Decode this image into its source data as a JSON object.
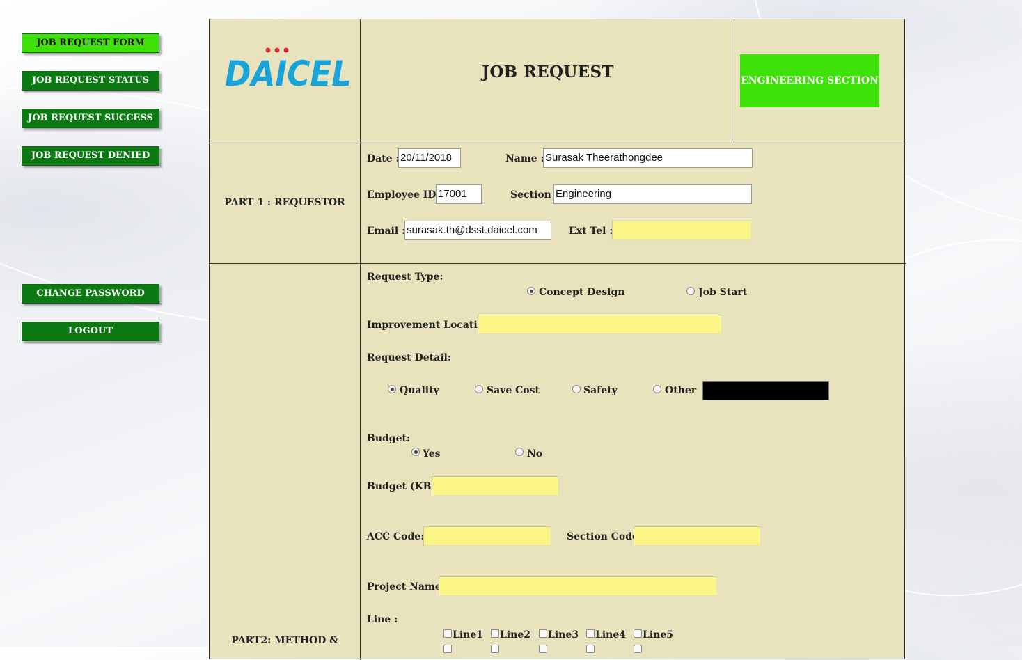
{
  "sidebar": {
    "items": [
      {
        "label": "JOB REQUEST FORM"
      },
      {
        "label": "JOB REQUEST STATUS"
      },
      {
        "label": "JOB REQUEST SUCCESS"
      },
      {
        "label": "JOB REQUEST DENIED"
      },
      {
        "label": "CHANGE PASSWORD"
      },
      {
        "label": "LOGOUT"
      }
    ]
  },
  "header": {
    "logo_text": "DAICEL",
    "title": "JOB REQUEST",
    "section_badge": "ENGINEERING SECTION"
  },
  "part1": {
    "label": "PART 1 : REQUESTOR",
    "date_label": "Date :",
    "date_value": "20/11/2018",
    "name_label": "Name :",
    "name_value": "Surasak Theerathongdee",
    "empid_label": "Employee ID :",
    "empid_value": "17001",
    "section_label": "Section :",
    "section_value": "Engineering",
    "email_label": "Email :",
    "email_value": "surasak.th@dsst.daicel.com",
    "exttel_label": "Ext Tel :",
    "exttel_value": ""
  },
  "part2": {
    "label": "PART2: METHOD &",
    "request_type_label": "Request Type:",
    "request_type_options": [
      "Concept Design",
      "Job Start"
    ],
    "request_type_selected": "Concept Design",
    "improvement_location_label": "Improvement Location:",
    "request_detail_label": "Request Detail:",
    "request_detail_options": [
      "Quality",
      "Save Cost",
      "Safety",
      "Other"
    ],
    "request_detail_selected": "Quality",
    "budget_label": "Budget:",
    "budget_options": [
      "Yes",
      "No"
    ],
    "budget_selected": "Yes",
    "budget_kb_label": "Budget (KB):",
    "acc_code_label": "ACC Code:",
    "section_code_label": "Section Code:",
    "project_name_label": "Project Name :",
    "line_label": "Line :",
    "lines": [
      "Line1",
      "Line2",
      "Line3",
      "Line4",
      "Line5"
    ]
  },
  "colors": {
    "nav_button": "#0c7a12",
    "nav_active": "#3ee108",
    "form_background": "#e9e3bd",
    "required_field": "#fbf586",
    "logo_blue": "#1aa3d9",
    "logo_dots": "#d8262c"
  }
}
